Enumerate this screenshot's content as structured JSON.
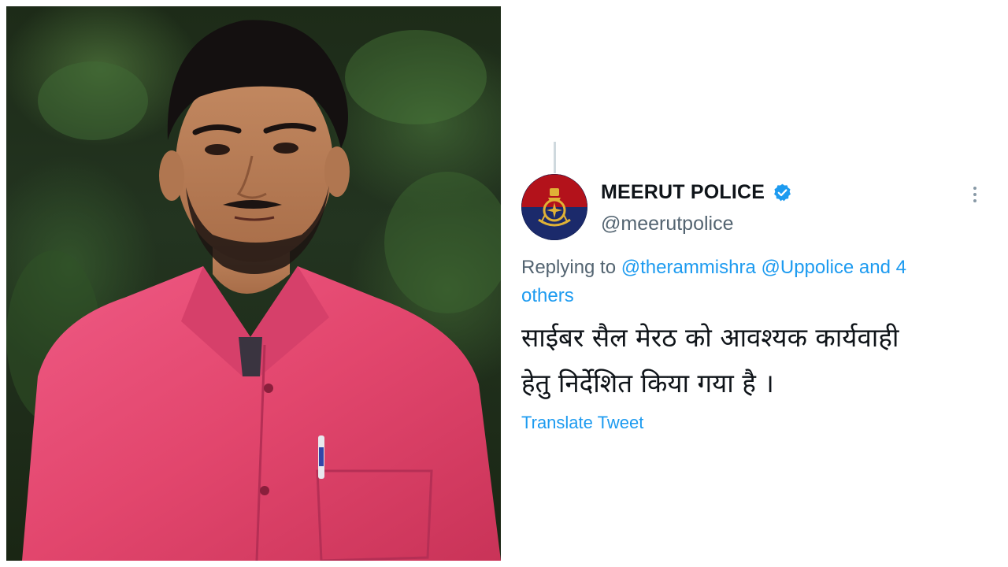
{
  "tweet": {
    "display_name": "MEERUT POLICE",
    "handle": "@meerutpolice",
    "replying_prefix": "Replying to",
    "mentions": [
      "@therammishra",
      "@Uppolice"
    ],
    "and_label": "and 4",
    "others_label": "others",
    "text_line1": "साईबर सैल मेरठ को आवश्यक कार्यवाही",
    "text_line2": "हेतु निर्देशित किया गया है ।",
    "translate_label": "Translate Tweet"
  },
  "icons": {
    "verified": "verified-badge-icon",
    "more": "more-dots-icon",
    "avatar_emblem": "up-police-emblem"
  },
  "colors": {
    "link_blue": "#1d9bf0",
    "text_dark": "#0f1419",
    "text_gray": "#536471",
    "emblem_red": "#b3121b",
    "emblem_navy": "#1b2a6b",
    "shirt_pink": "#e2466d"
  }
}
